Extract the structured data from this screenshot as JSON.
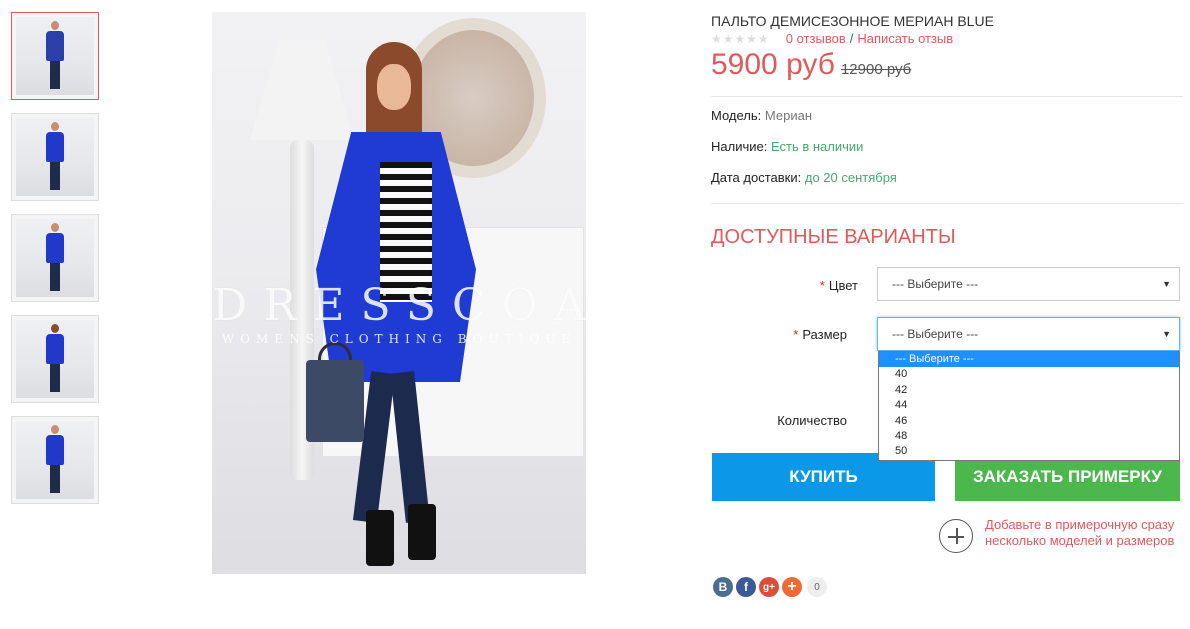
{
  "thumbnails": [
    {
      "alt": "thumb-1"
    },
    {
      "alt": "thumb-2"
    },
    {
      "alt": "thumb-3"
    },
    {
      "alt": "thumb-4"
    },
    {
      "alt": "thumb-5"
    }
  ],
  "main_image": {
    "watermark_main": "DRESSCOAT",
    "watermark_sub": "WOMENS CLOTHING BOUTIQUE"
  },
  "product": {
    "title": "ПАЛЬТО ДЕМИСЕЗОННОЕ МЕРИАН BLUE",
    "stars": "★★★★★",
    "reviews_link": "0 отзывов",
    "separator": "/",
    "write_review_link": "Написать отзыв",
    "price_new": "5900 руб",
    "price_old": "12900 руб"
  },
  "specs": {
    "model_label": "Модель:",
    "model_value": "Мериан",
    "stock_label": "Наличие:",
    "stock_value": "Есть в наличии",
    "delivery_label": "Дата доставки:",
    "delivery_value": "до 20 сентября"
  },
  "variants": {
    "title": "ДОСТУПНЫЕ ВАРИАНТЫ",
    "required_mark": "*",
    "color_label": "Цвет",
    "color_selected": "--- Выберите ---",
    "size_label": "Размер",
    "size_selected": "--- Выберите ---",
    "size_options": [
      "--- Выберите ---",
      "40",
      "42",
      "44",
      "46",
      "48",
      "50"
    ],
    "quantity_label": "Количество"
  },
  "buttons": {
    "buy": "КУПИТЬ",
    "fitting": "ЗАКАЗАТЬ ПРИМЕРКУ"
  },
  "add_fitting_text": "Добавьте в примерочную сразу несколько моделей и размеров",
  "social": {
    "vk": "B",
    "fb": "f",
    "gplus": "g+",
    "share": "+",
    "count": "0"
  },
  "colors": {
    "accent_red": "#e05a5a",
    "buy_blue": "#0b98e8",
    "fit_green": "#4cb74c",
    "stock_green": "#48a86c"
  }
}
